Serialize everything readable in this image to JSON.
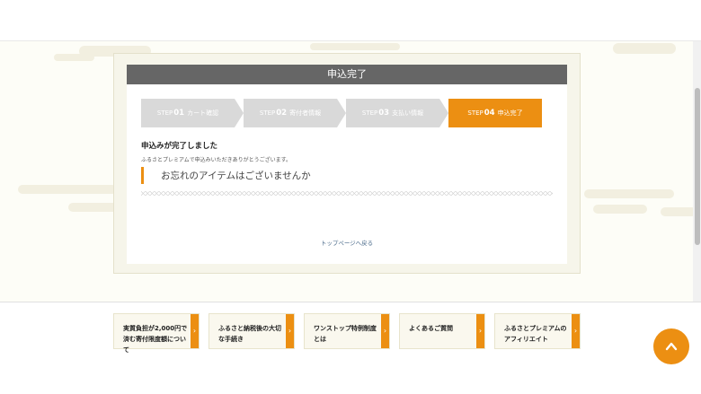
{
  "page": {
    "title": "申込完了"
  },
  "steps": [
    {
      "prefix": "STEP",
      "num": "01",
      "label": "カート確認",
      "active": false
    },
    {
      "prefix": "STEP",
      "num": "02",
      "label": "寄付者情報",
      "active": false
    },
    {
      "prefix": "STEP",
      "num": "03",
      "label": "支払い情報",
      "active": false
    },
    {
      "prefix": "STEP",
      "num": "04",
      "label": "申込完了",
      "active": true
    }
  ],
  "complete": {
    "heading": "申込みが完了しました",
    "message": "ふるさとプレミアムで申込みいただきありがとうございます。",
    "forget_title": "お忘れのアイテムはございませんか",
    "top_link": "トップページへ戻る"
  },
  "footer": {
    "links": [
      {
        "label": "実質負担が2,000円で済む寄付限度額について",
        "arrow": "›"
      },
      {
        "label": "ふるさと納税後の大切な手続き",
        "arrow": "›"
      },
      {
        "label": "ワンストップ特例制度とは",
        "arrow": "›"
      },
      {
        "label": "よくあるご質問",
        "arrow": "›"
      },
      {
        "label": "ふるさとプレミアムのアフィリエイト",
        "arrow": "›"
      }
    ]
  },
  "colors": {
    "accent": "#ec8f12",
    "title_bar": "#666666",
    "step_inactive": "#d9d9d9"
  },
  "icons": {
    "back_to_top": "chevron-up-icon"
  }
}
